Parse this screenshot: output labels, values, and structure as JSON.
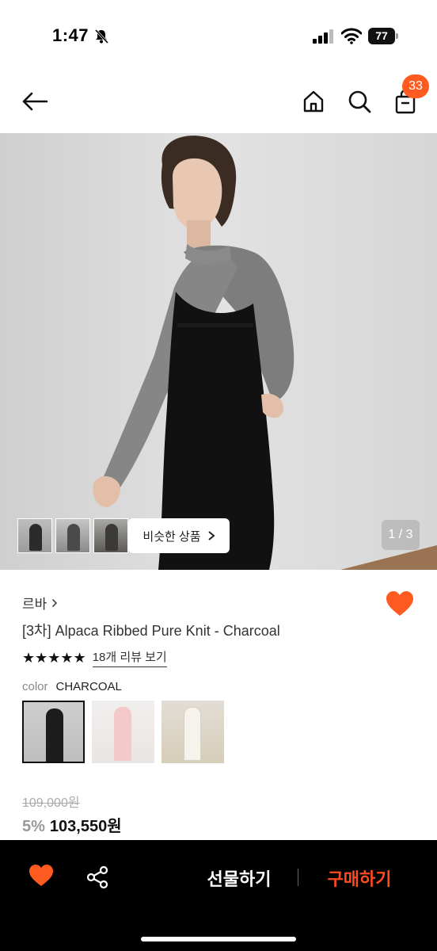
{
  "status_bar": {
    "time": "1:47",
    "battery": "77",
    "icons": [
      "bell-slash-icon",
      "signal-icon",
      "wifi-icon",
      "battery-icon"
    ]
  },
  "nav": {
    "icons": [
      "back-arrow-icon",
      "home-icon",
      "search-icon",
      "bag-icon"
    ],
    "cart_count": "33"
  },
  "gallery": {
    "similar_label": "비슷한 상품",
    "page_indicator": "1 / 3"
  },
  "product": {
    "brand": "르바",
    "title": "[3차] Alpaca Ribbed Pure Knit - Charcoal",
    "rating_stars": "★★★★★",
    "rating_value": 5,
    "review_link": "18개 리뷰 보기",
    "color_label": "color",
    "color_value": "CHARCOAL",
    "original_price": "109,000원",
    "discount_rate": "5%",
    "sale_price": "103,550원"
  },
  "bottom_bar": {
    "gift_label": "선물하기",
    "buy_label": "구매하기"
  },
  "colors": {
    "accent": "#ff4b1f",
    "badge": "#ff5a1f",
    "heart": "#ff5a1f"
  }
}
